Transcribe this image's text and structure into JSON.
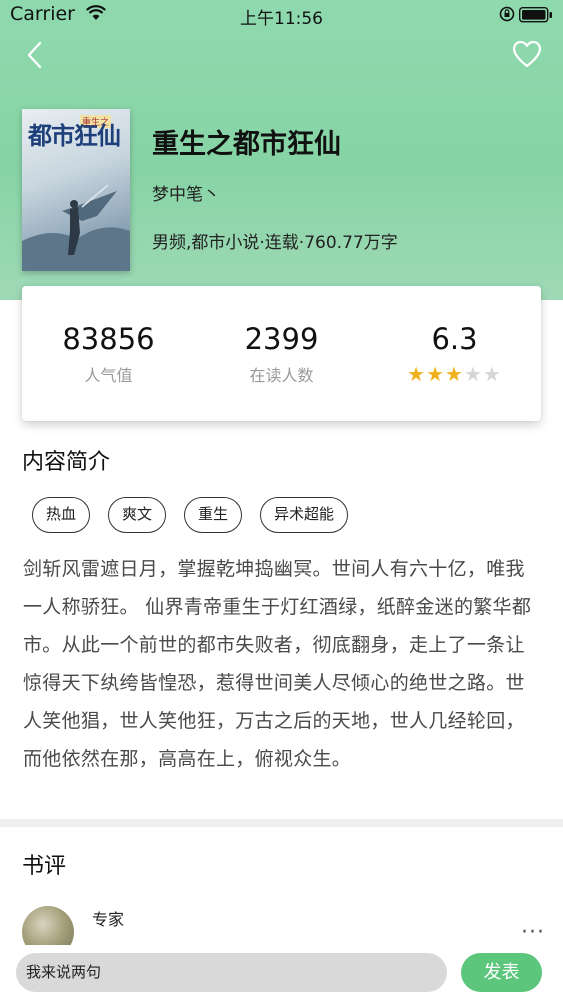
{
  "status_bar": {
    "carrier": "Carrier",
    "time": "上午11:56"
  },
  "header": {
    "back_icon": "chevron-left-icon",
    "favorite_icon": "heart-outline-icon",
    "gradient_color": "#8fd9ae"
  },
  "book": {
    "cover_title": "都市狂仙",
    "cover_tag": "重生之",
    "title": "重生之都市狂仙",
    "author": "梦中笔丶",
    "meta": "男频,都市小说·连载·760.77万字"
  },
  "stats": [
    {
      "value": "83856",
      "label": "人气值"
    },
    {
      "value": "2399",
      "label": "在读人数"
    },
    {
      "value": "6.3",
      "label": "",
      "rating": 3,
      "rating_max": 5
    }
  ],
  "intro": {
    "title": "内容简介",
    "tags": [
      "热血",
      "爽文",
      "重生",
      "异术超能"
    ],
    "text": "剑斩风雷遮日月，掌握乾坤捣幽冥。世间人有六十亿，唯我一人称骄狂。 仙界青帝重生于灯红酒绿，纸醉金迷的繁华都市。从此一个前世的都市失败者，彻底翻身，走上了一条让惊得天下纨绔皆惶恐，惹得世间美人尽倾心的绝世之路。世人笑他猖，世人笑他狂，万古之后的天地，世人几经轮回，而他依然在那，高高在上，俯视众生。"
  },
  "reviews": {
    "title": "书评",
    "items": [
      {
        "name": "专家"
      }
    ]
  },
  "comment_bar": {
    "input_value": "我来说两句",
    "send_label": "发表",
    "send_color": "#5cc77c"
  }
}
